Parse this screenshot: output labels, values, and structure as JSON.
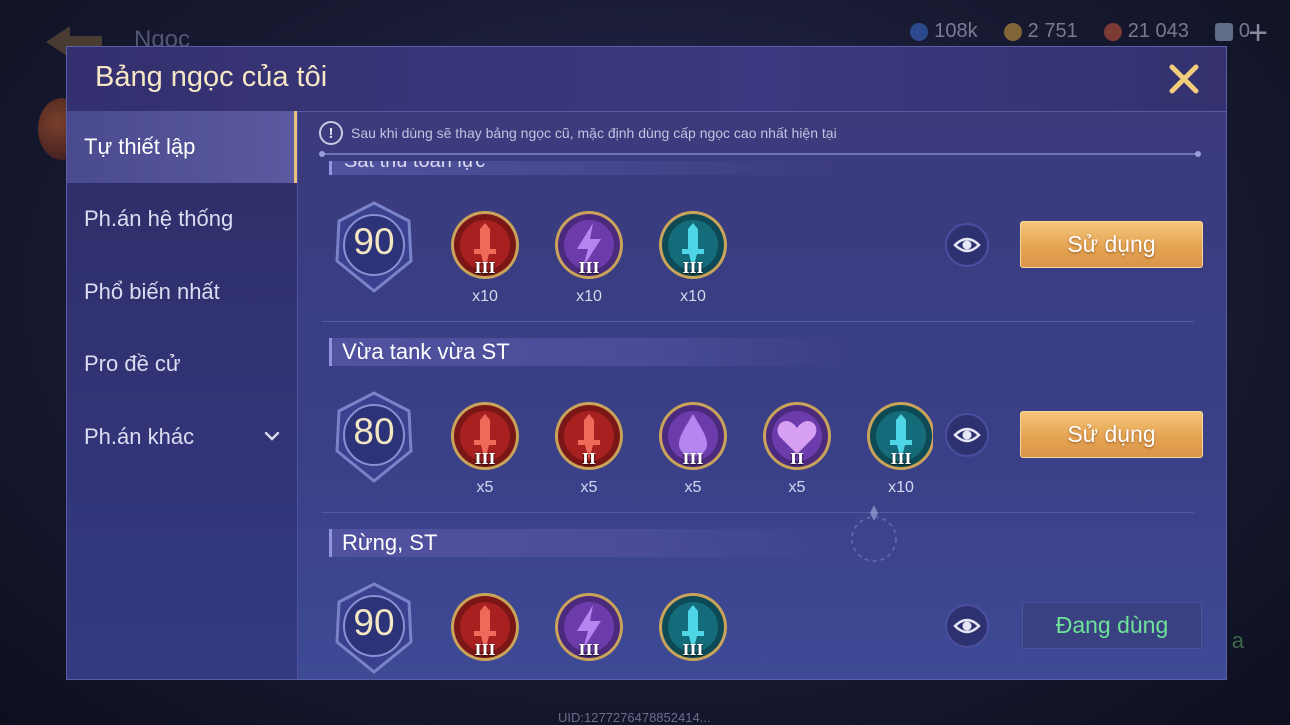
{
  "background": {
    "title": "Ngọc",
    "currencies": [
      {
        "icon": "blue-gem-icon",
        "value": "108k",
        "color": "#3f6fd8"
      },
      {
        "icon": "gold-coin-icon",
        "value": "2 751",
        "color": "#d9a23c"
      },
      {
        "icon": "red-gem-icon",
        "value": "21 043",
        "color": "#d4583a"
      },
      {
        "icon": "ticket-icon",
        "value": "0",
        "color": "#9fb6d8"
      }
    ],
    "uid": "UID:1277276478852414...",
    "right_label": "a"
  },
  "modal": {
    "title": "Bảng ngọc của tôi",
    "notice": "Sau khi dùng sẽ thay bảng ngọc cũ, mặc định dùng cấp ngọc cao nhất hiện tại"
  },
  "sidebar": {
    "items": [
      {
        "label": "Tự thiết lập",
        "active": true
      },
      {
        "label": "Ph.án hệ thống",
        "active": false
      },
      {
        "label": "Phổ biến nhất",
        "active": false
      },
      {
        "label": "Pro đề cử",
        "active": false
      },
      {
        "label": "Ph.án khác",
        "active": false,
        "expandable": true
      }
    ]
  },
  "pages": [
    {
      "name": "Sát thủ toàn lực",
      "level": "90",
      "runes": [
        {
          "type": "red",
          "icon": "sword-icon",
          "tier": "III",
          "count": "x10"
        },
        {
          "type": "purple",
          "icon": "lightning-icon",
          "tier": "III",
          "count": "x10"
        },
        {
          "type": "teal",
          "icon": "sword-icon",
          "tier": "III",
          "count": "x10"
        }
      ],
      "action": "Sử dụng"
    },
    {
      "name": "Vừa tank vừa ST",
      "level": "80",
      "runes": [
        {
          "type": "red",
          "icon": "sword-icon",
          "tier": "III",
          "count": "x5"
        },
        {
          "type": "red",
          "icon": "sword-icon",
          "tier": "II",
          "count": "x5"
        },
        {
          "type": "purple",
          "icon": "drop-icon",
          "tier": "III",
          "count": "x5"
        },
        {
          "type": "purple",
          "icon": "heart-icon",
          "tier": "II",
          "count": "x5"
        },
        {
          "type": "teal",
          "icon": "sword-icon",
          "tier": "III",
          "count": "x10"
        }
      ],
      "action": "Sử dụng"
    },
    {
      "name": "Rừng, ST",
      "level": "90",
      "runes": [
        {
          "type": "red",
          "icon": "sword-icon",
          "tier": "III",
          "count": ""
        },
        {
          "type": "purple",
          "icon": "lightning-icon",
          "tier": "III",
          "count": ""
        },
        {
          "type": "teal",
          "icon": "sword-icon",
          "tier": "III",
          "count": ""
        }
      ],
      "action": "Đang dùng"
    }
  ]
}
